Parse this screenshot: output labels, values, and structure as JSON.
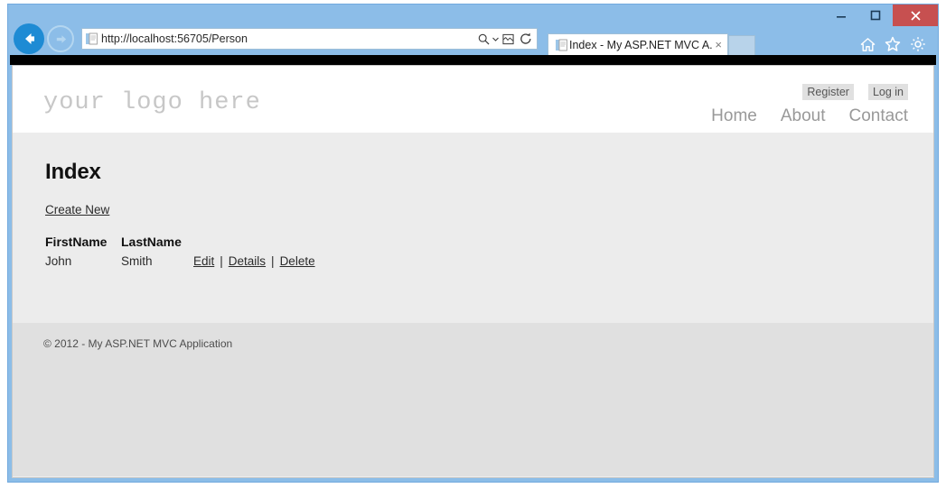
{
  "window": {
    "controls": {
      "minimize_label": "Minimize",
      "maximize_label": "Maximize",
      "close_label": "Close"
    },
    "frame_color": "#8cbde8",
    "close_color": "#c75050"
  },
  "browser": {
    "back_label": "Back",
    "forward_label": "Forward",
    "address": {
      "url": "http://localhost:56705/Person",
      "placeholder": "",
      "favicon": "page-icon",
      "tools": [
        {
          "name": "search-icon",
          "label": "Search"
        },
        {
          "name": "chevron-down-icon",
          "label": "Search options"
        },
        {
          "name": "compatibility-view-icon",
          "label": "Compatibility View"
        },
        {
          "name": "refresh-icon",
          "label": "Refresh"
        }
      ]
    },
    "tabs": [
      {
        "title": "Index - My ASP.NET MVC A...",
        "close_label": "×",
        "favicon": "page-icon",
        "active": true
      }
    ],
    "new_tab_label": "New tab",
    "toolbar_icons": [
      {
        "name": "home-icon",
        "label": "Home"
      },
      {
        "name": "favorites-star-icon",
        "label": "Favorites"
      },
      {
        "name": "settings-gear-icon",
        "label": "Tools"
      }
    ]
  },
  "page": {
    "header": {
      "brand": "your logo here",
      "account_links": [
        {
          "label": "Register"
        },
        {
          "label": "Log in"
        }
      ],
      "nav_links": [
        {
          "label": "Home"
        },
        {
          "label": "About"
        },
        {
          "label": "Contact"
        }
      ]
    },
    "main": {
      "title": "Index",
      "create_link": "Create New",
      "table": {
        "columns": [
          "FirstName",
          "LastName",
          ""
        ],
        "rows": [
          {
            "first_name": "John",
            "last_name": "Smith",
            "actions": [
              {
                "label": "Edit"
              },
              {
                "label": "Details"
              },
              {
                "label": "Delete"
              }
            ],
            "separator": "|"
          }
        ]
      }
    },
    "footer": {
      "copyright": "© 2012 - My ASP.NET MVC Application"
    }
  }
}
